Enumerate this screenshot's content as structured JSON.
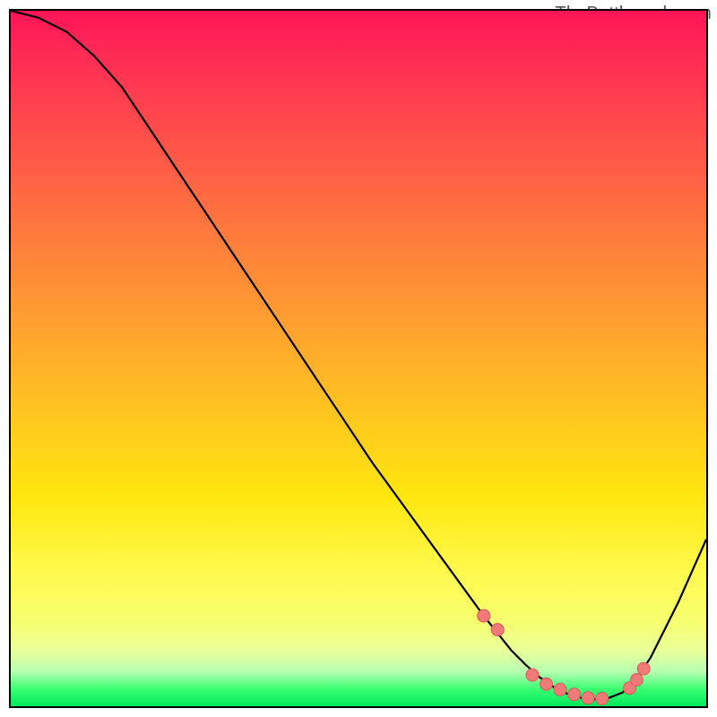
{
  "watermark": "TheBottleneck.com",
  "colors": {
    "curve": "#000000",
    "marker_fill": "#ef7a78",
    "marker_stroke": "#d85a5a"
  },
  "chart_data": {
    "type": "line",
    "title": "",
    "xlabel": "",
    "ylabel": "",
    "xlim": [
      0,
      100
    ],
    "ylim": [
      0,
      100
    ],
    "note": "x is horizontal position (0..100 across plot), y is bottleneck percentage (0 at bottom, 100 at top). Curve is the black trace; markers are the salmon dots near the trough.",
    "series": [
      {
        "name": "curve",
        "x": [
          0,
          4,
          8,
          12,
          16,
          20,
          24,
          28,
          32,
          36,
          40,
          44,
          48,
          52,
          56,
          60,
          64,
          68,
          72,
          74,
          76,
          78,
          80,
          82,
          84,
          86,
          88,
          90,
          92,
          96,
          100
        ],
        "y": [
          100,
          99,
          97,
          93.5,
          89,
          83,
          77,
          71,
          65,
          59,
          53,
          47,
          41,
          35,
          29.5,
          24,
          18.5,
          13,
          8,
          6,
          4.2,
          2.8,
          1.8,
          1.2,
          1,
          1.2,
          2,
          4,
          7,
          15,
          24
        ]
      }
    ],
    "markers": {
      "x": [
        68,
        70,
        75,
        77,
        79,
        81,
        83,
        85,
        89,
        90,
        91
      ],
      "y": [
        13,
        11,
        4.5,
        3.2,
        2.4,
        1.7,
        1.2,
        1.1,
        2.6,
        3.8,
        5.4
      ]
    }
  }
}
